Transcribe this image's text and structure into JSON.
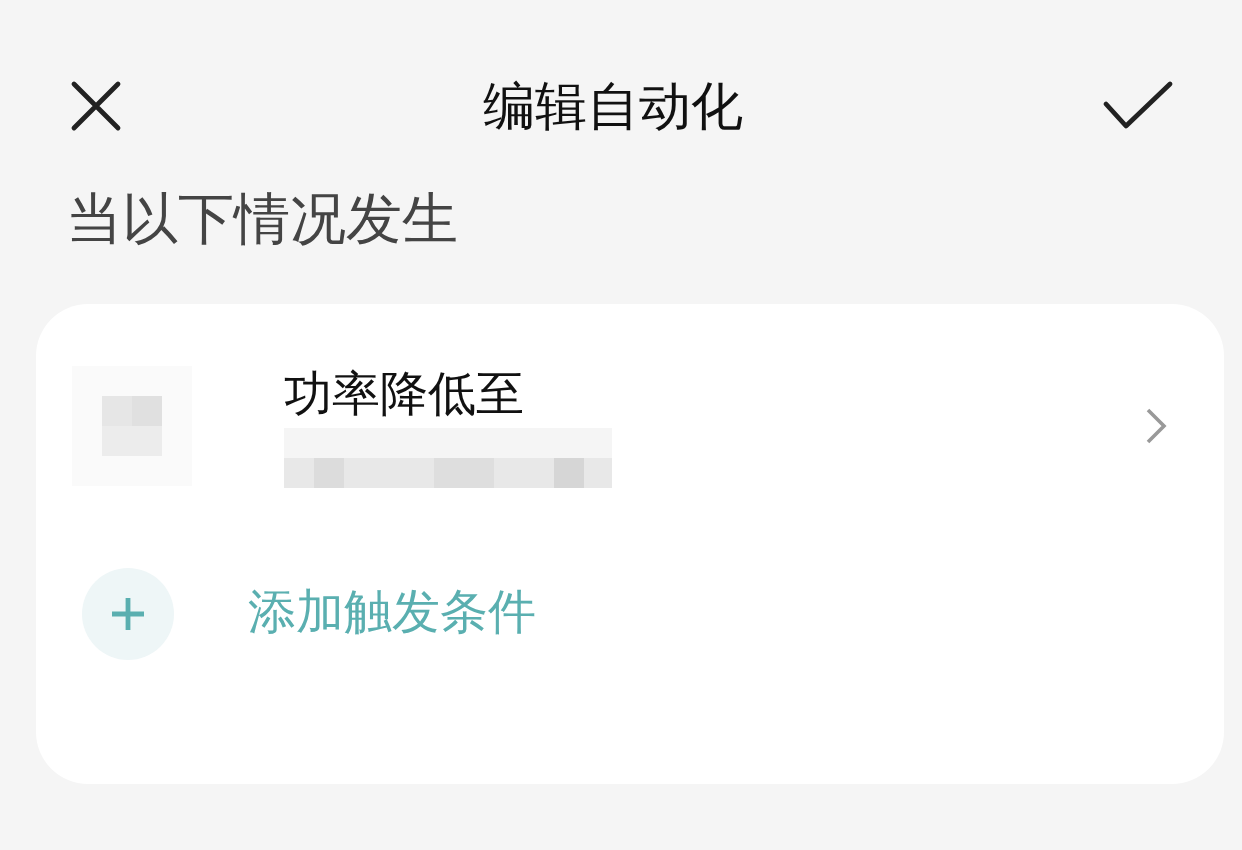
{
  "header": {
    "title": "编辑自动化"
  },
  "section_title": "当以下情况发生",
  "triggers": [
    {
      "kind": "condition",
      "title": "功率降低至"
    }
  ],
  "add_trigger": {
    "label": "添加触发条件"
  }
}
